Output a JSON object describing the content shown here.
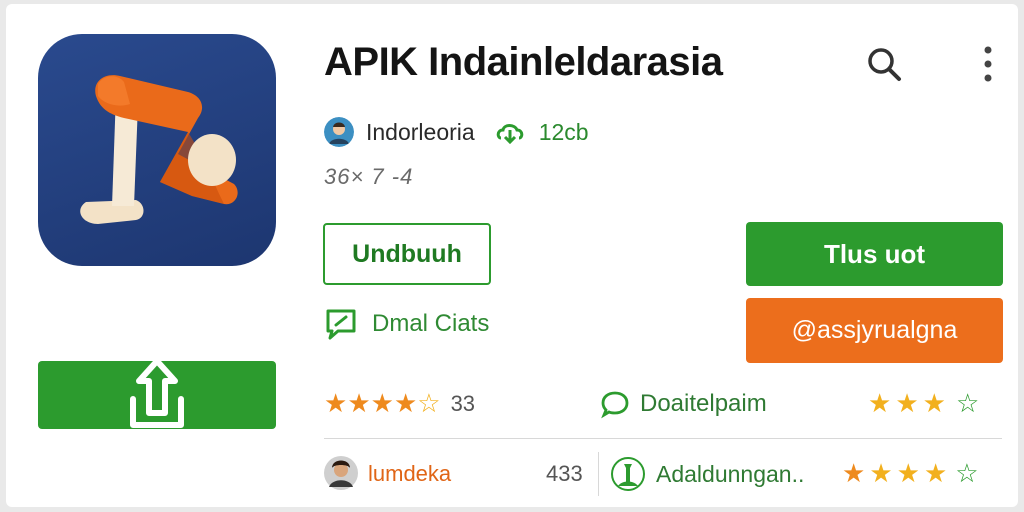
{
  "app": {
    "title": "APIK Indainleldarasia",
    "developer": "Indorleoria",
    "size": "12cb",
    "meta": "36× 7 -4"
  },
  "actions": {
    "download_label": "Undbuuh",
    "primary_label": "Tlus uot",
    "secondary_label": "@assjyrualgna",
    "chat_label": "Dmal Ciats"
  },
  "ratings": {
    "row1": {
      "stars": 4.5,
      "count": "33"
    },
    "discussion_label": "Doaitelpaim",
    "row1_right": {
      "stars": 3
    }
  },
  "reviews": {
    "reviewer_name": "lumdeka",
    "review_count": "433",
    "app_name": "Adaldunngan..",
    "stars": 4
  },
  "colors": {
    "accent_green": "#2c9b2e",
    "accent_orange": "#ec6e1c",
    "icon_bg": "#1d3670"
  }
}
